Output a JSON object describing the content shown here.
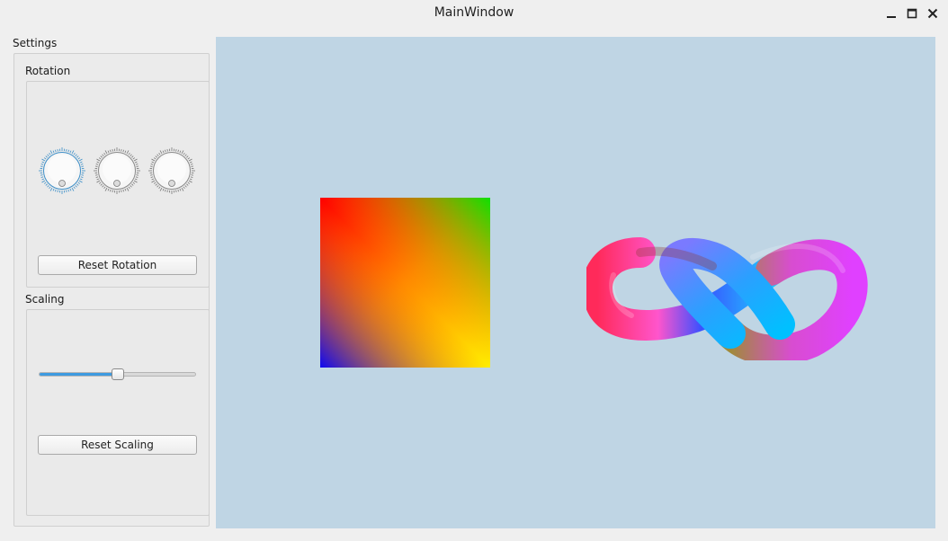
{
  "window": {
    "title": "MainWindow",
    "controls": [
      "minimize-icon",
      "maximize-icon",
      "close-icon"
    ]
  },
  "settings": {
    "label": "Settings",
    "rotation": {
      "label": "Rotation",
      "dials": [
        {
          "name": "rotation-dial-x",
          "state": "focused"
        },
        {
          "name": "rotation-dial-y",
          "state": "normal"
        },
        {
          "name": "rotation-dial-z",
          "state": "normal"
        }
      ],
      "reset_label": "Reset Rotation"
    },
    "scaling": {
      "label": "Scaling",
      "slider_value": 0.5,
      "reset_label": "Reset Scaling"
    }
  },
  "viewport": {
    "background": "#bfd5e4",
    "objects": [
      "gradient-quad",
      "trefoil-knot"
    ]
  },
  "colors": {
    "accent": "#3d9ae0",
    "panel": "#ebebeb"
  }
}
